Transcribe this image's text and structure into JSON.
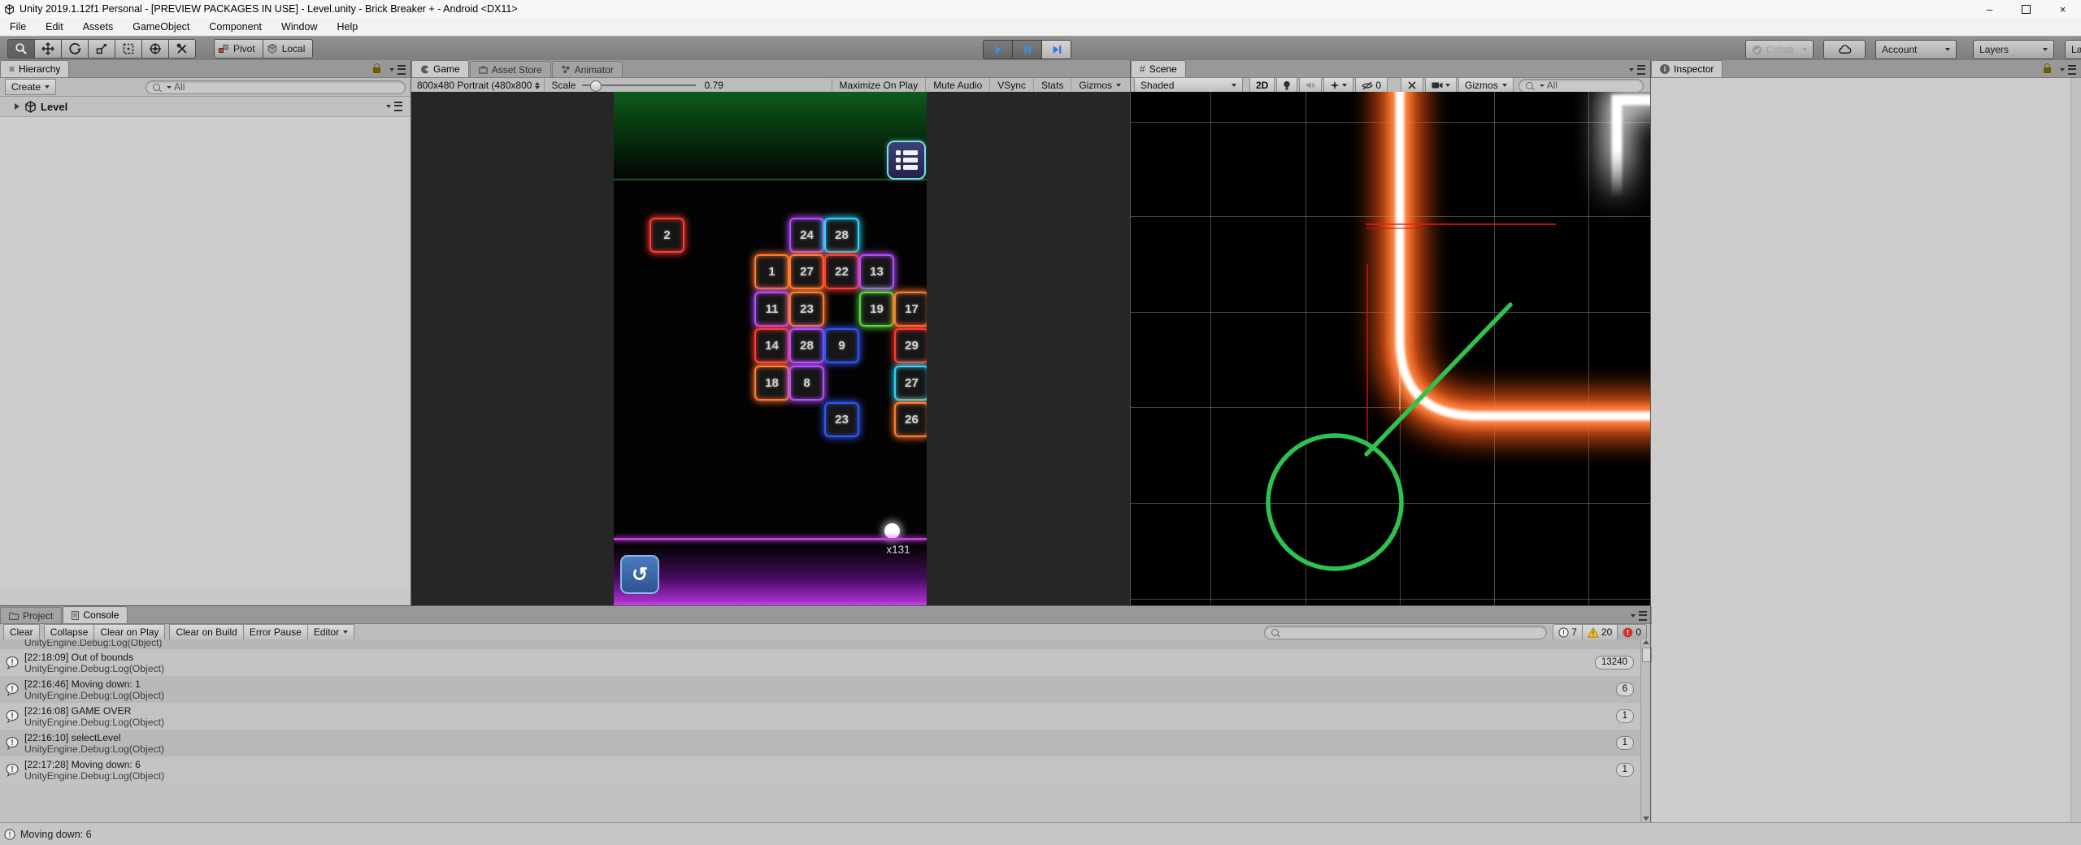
{
  "window": {
    "title": "Unity 2019.1.12f1 Personal - [PREVIEW PACKAGES IN USE] - Level.unity - Brick Breaker + - Android <DX11>",
    "controls": {
      "minimize": "–",
      "close": "×"
    }
  },
  "menu_bar": {
    "items": [
      "File",
      "Edit",
      "Assets",
      "GameObject",
      "Component",
      "Window",
      "Help"
    ]
  },
  "toolbar": {
    "tools": [
      "view-tool",
      "move-tool",
      "rotate-tool",
      "scale-tool",
      "rect-tool",
      "transform-tool",
      "custom-tool"
    ],
    "active_tool": 0,
    "pivot_label": "Pivot",
    "local_label": "Local",
    "collab_label": "Collab",
    "account_label": "Account",
    "layers_label": "Layers",
    "layout_label": "Layout"
  },
  "hierarchy": {
    "tab": "Hierarchy",
    "create_label": "Create",
    "search_text": "All",
    "scene_name": "Level"
  },
  "game": {
    "tabs": [
      "Game",
      "Asset Store",
      "Animator"
    ],
    "resolution": "800x480 Portrait (480x800",
    "scale_label": "Scale",
    "scale_value": "0.79",
    "buttons": [
      "Maximize On Play",
      "Mute Audio",
      "VSync",
      "Stats",
      "Gizmos"
    ],
    "multiplier": "x131",
    "brick_palette": {
      "red": "#ff3a30",
      "orange": "#ff7a2f",
      "purple": "#b44dff",
      "cyan": "#2fd4f5",
      "green": "#5ad942",
      "blue": "#3355f0"
    },
    "bricks": [
      {
        "n": "2",
        "col": 1,
        "row": 0,
        "color": "red"
      },
      {
        "n": "24",
        "col": 5,
        "row": 0,
        "color": "purple"
      },
      {
        "n": "28",
        "col": 6,
        "row": 0,
        "color": "cyan"
      },
      {
        "n": "1",
        "col": 4,
        "row": 1,
        "color": "orange"
      },
      {
        "n": "27",
        "col": 5,
        "row": 1,
        "color": "orange"
      },
      {
        "n": "22",
        "col": 6,
        "row": 1,
        "color": "red"
      },
      {
        "n": "13",
        "col": 7,
        "row": 1,
        "color": "purple"
      },
      {
        "n": "11",
        "col": 4,
        "row": 2,
        "color": "purple"
      },
      {
        "n": "23",
        "col": 5,
        "row": 2,
        "color": "orange"
      },
      {
        "n": "19",
        "col": 7,
        "row": 2,
        "color": "green"
      },
      {
        "n": "17",
        "col": 8,
        "row": 2,
        "color": "orange"
      },
      {
        "n": "14",
        "col": 4,
        "row": 3,
        "color": "red"
      },
      {
        "n": "28",
        "col": 5,
        "row": 3,
        "color": "purple"
      },
      {
        "n": "9",
        "col": 6,
        "row": 3,
        "color": "blue"
      },
      {
        "n": "29",
        "col": 8,
        "row": 3,
        "color": "red"
      },
      {
        "n": "18",
        "col": 4,
        "row": 4,
        "color": "orange"
      },
      {
        "n": "8",
        "col": 5,
        "row": 4,
        "color": "purple"
      },
      {
        "n": "27",
        "col": 8,
        "row": 4,
        "color": "cyan"
      },
      {
        "n": "23",
        "col": 6,
        "row": 5,
        "color": "blue"
      },
      {
        "n": "26",
        "col": 8,
        "row": 5,
        "color": "orange"
      }
    ]
  },
  "scene": {
    "tab": "Scene",
    "shaded_label": "Shaded",
    "toggle_2d": "2D",
    "visibility_count": "0",
    "gizmos_label": "Gizmos",
    "search_text": "All",
    "accent_green": "#2fc24f",
    "neon_orange": "#ff5a14"
  },
  "inspector": {
    "tab": "Inspector"
  },
  "console": {
    "tabs": [
      "Project",
      "Console"
    ],
    "buttons": [
      "Clear",
      "Collapse",
      "Clear on Play",
      "Clear on Build",
      "Error Pause",
      "Editor"
    ],
    "counts": {
      "info": "7",
      "warning": "20",
      "error": "0"
    },
    "partial_top_line": "UnityEngine.Debug:Log(Object)",
    "entries": [
      {
        "message": "[22:18:09] Out of bounds",
        "detail": "UnityEngine.Debug:Log(Object)",
        "count": "13240"
      },
      {
        "message": "[22:16:46] Moving down: 1",
        "detail": "UnityEngine.Debug:Log(Object)",
        "count": "6"
      },
      {
        "message": "[22:16:08] GAME OVER",
        "detail": "UnityEngine.Debug:Log(Object)",
        "count": "1"
      },
      {
        "message": "[22:16:10] selectLevel",
        "detail": "UnityEngine.Debug:Log(Object)",
        "count": "1"
      },
      {
        "message": "[22:17:28] Moving down: 6",
        "detail": "UnityEngine.Debug:Log(Object)",
        "count": "1"
      }
    ]
  },
  "status_bar": {
    "message": "Moving down: 6"
  }
}
